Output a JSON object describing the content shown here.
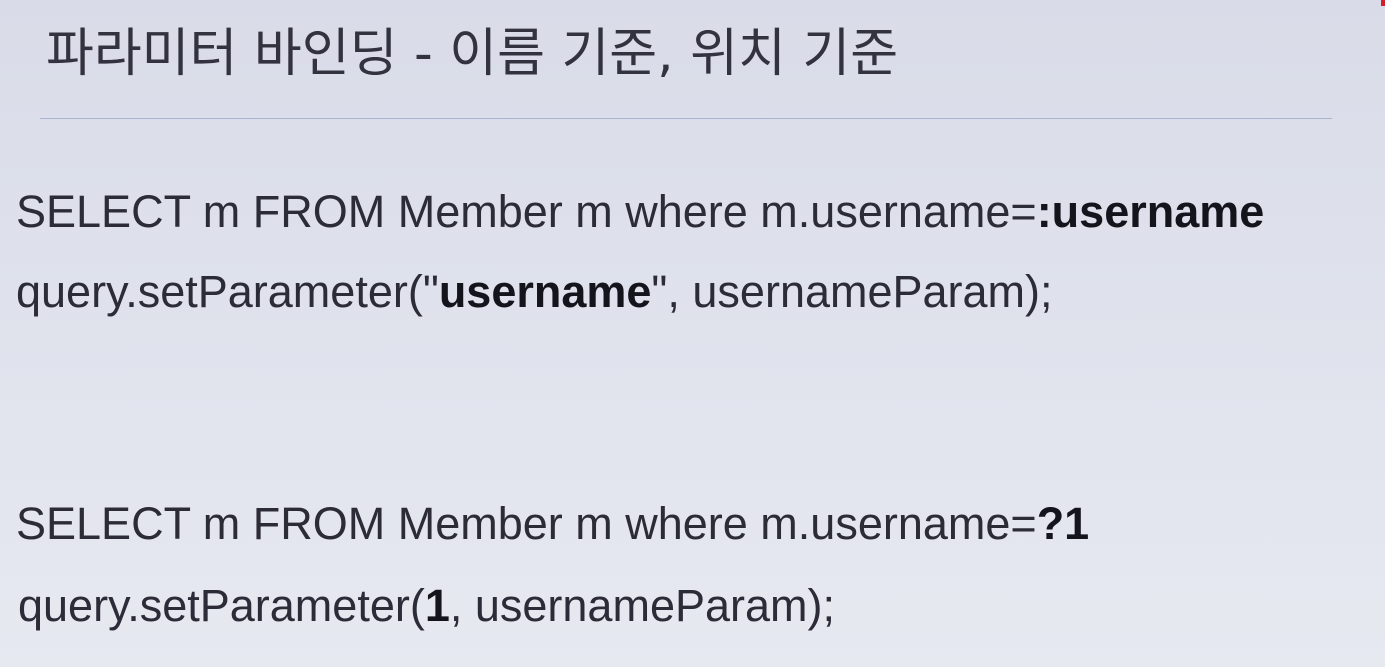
{
  "slide": {
    "title": "파라미터 바인딩 - 이름 기준, 위치 기준",
    "named_example": {
      "query_prefix": "SELECT m FROM Member m where m.username=",
      "query_param": ":username",
      "call_prefix": "query.setParameter(\"",
      "call_param": "username",
      "call_suffix": "\", usernameParam);"
    },
    "positional_example": {
      "query_prefix": "SELECT m FROM Member m where m.username=",
      "query_param": "?1",
      "call_prefix": "query.setParameter(",
      "call_param": "1",
      "call_suffix": ", usernameParam);"
    }
  },
  "colors": {
    "background": "#dfe2ec",
    "divider": "#a9b3cf",
    "text": "#2c2c38",
    "accent": "#d0202a"
  }
}
